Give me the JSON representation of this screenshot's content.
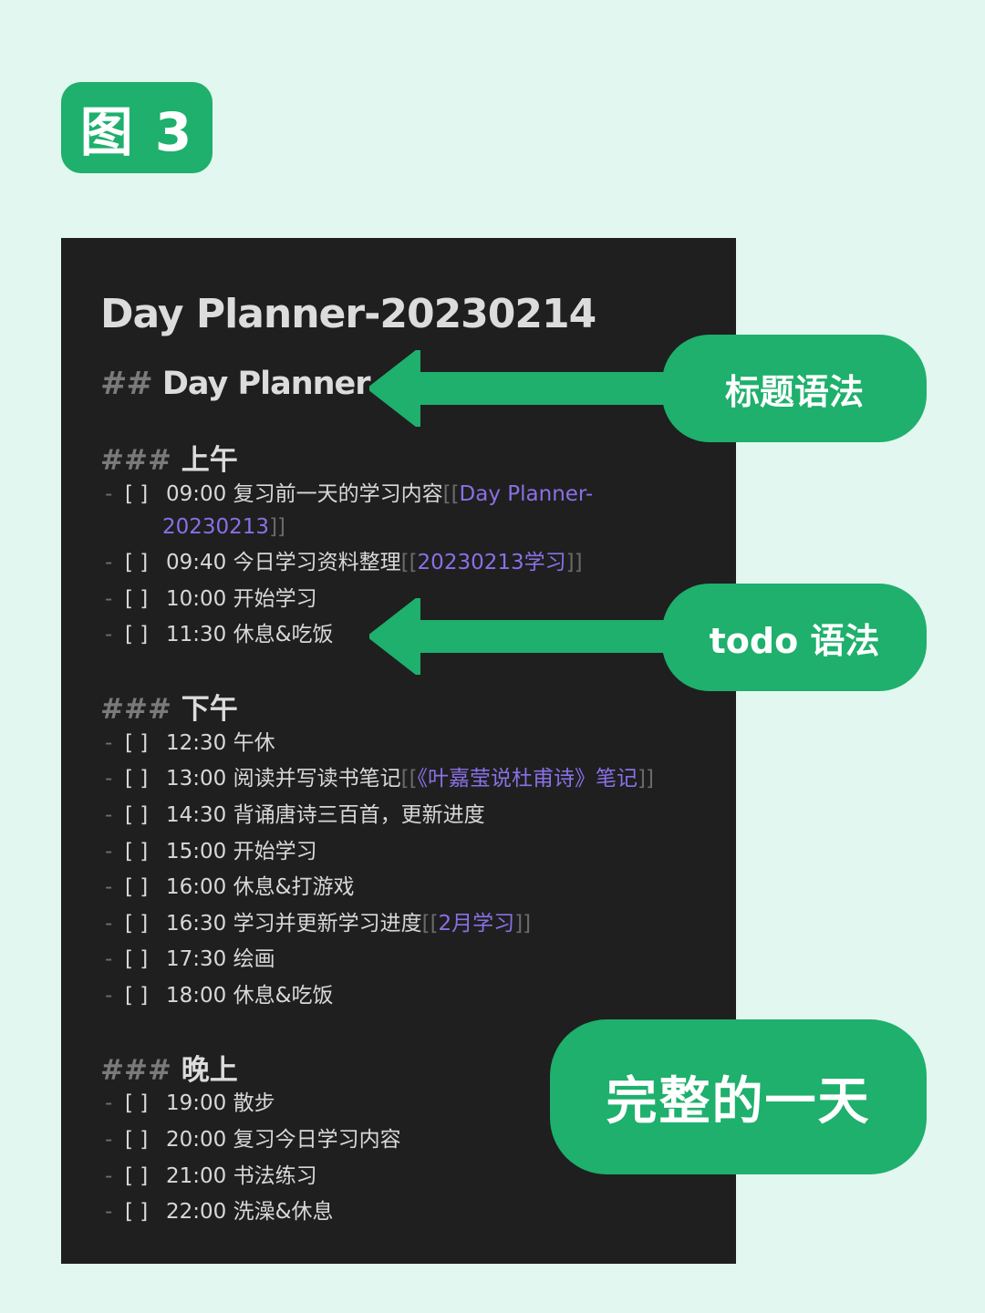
{
  "badge": "图 3",
  "doc": {
    "title": "Day Planner-20230214",
    "h2_marker": "##",
    "h2_text": "Day Planner",
    "h3_marker": "###",
    "dash": "-",
    "checkbox": "[   ]"
  },
  "sections": [
    {
      "heading": "上午",
      "tasks": [
        {
          "text": "09:00 复习前一天的学习内容",
          "link_open": "[[",
          "link": "Day Planner-",
          "link_cont": "20230213",
          "link_close": "]]"
        },
        {
          "text": "09:40 今日学习资料整理",
          "link_open": "[[",
          "link": "20230213学习",
          "link_close": "]]"
        },
        {
          "text": "10:00 开始学习"
        },
        {
          "text": "11:30 休息&吃饭"
        }
      ]
    },
    {
      "heading": "下午",
      "tasks": [
        {
          "text": "12:30 午休"
        },
        {
          "text": "13:00 阅读并写读书笔记",
          "link_open": "[[",
          "link": "《叶嘉莹说杜甫诗》笔记",
          "link_close": "]]"
        },
        {
          "text": "14:30 背诵唐诗三百首，更新进度"
        },
        {
          "text": "15:00 开始学习"
        },
        {
          "text": "16:00 休息&打游戏"
        },
        {
          "text": "16:30 学习并更新学习进度",
          "link_open": "[[",
          "link": "2月学习",
          "link_close": "]]"
        },
        {
          "text": "17:30 绘画"
        },
        {
          "text": "18:00 休息&吃饭"
        }
      ]
    },
    {
      "heading": "晚上",
      "tasks": [
        {
          "text": "19:00 散步"
        },
        {
          "text": "20:00 复习今日学习内容"
        },
        {
          "text": "21:00 书法练习"
        },
        {
          "text": "22:00 洗澡&休息"
        }
      ]
    }
  ],
  "callouts": {
    "heading_syntax": "标题语法",
    "todo_syntax": "todo  语法",
    "full_day": "完整的一天"
  },
  "colors": {
    "accent": "#1eb06c",
    "background": "#e2f7ef",
    "editor_bg": "#1f1f1f",
    "link": "#8a70e6"
  }
}
